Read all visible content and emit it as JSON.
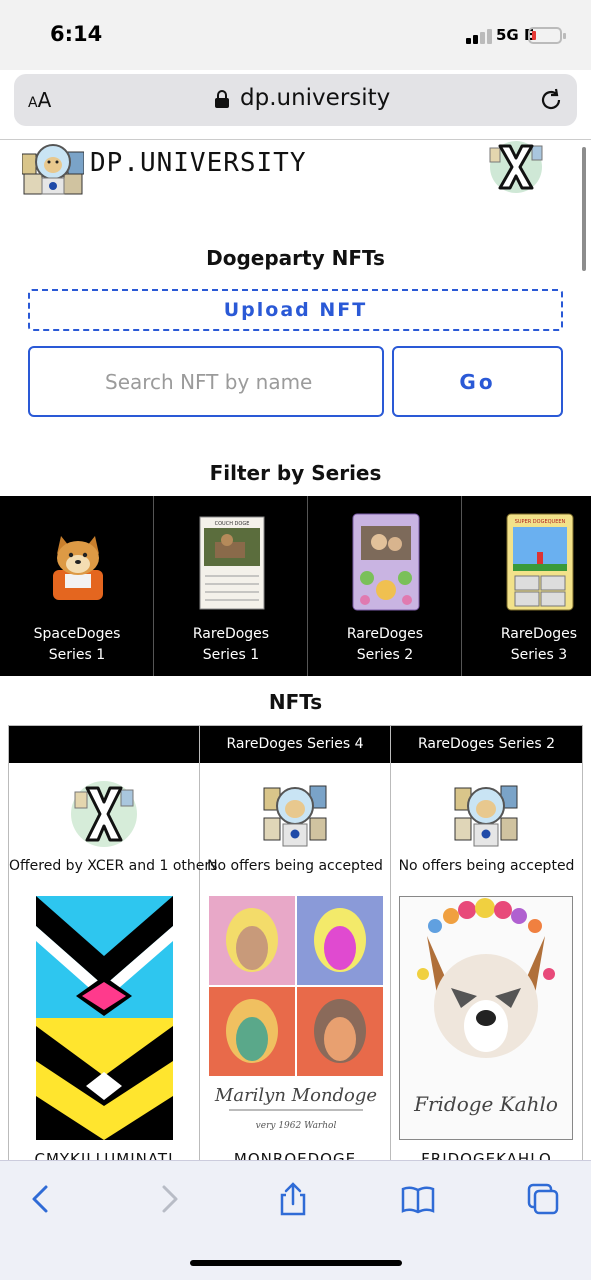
{
  "status_bar": {
    "time": "6:14",
    "network": "5G E"
  },
  "browser": {
    "aa_label": "AA",
    "domain": "dp.university"
  },
  "site": {
    "name": "DP.UNIVERSITY"
  },
  "main": {
    "title": "Dogeparty NFTs",
    "upload_label": "Upload NFT",
    "search_placeholder": "Search NFT by name",
    "go_label": "Go",
    "filter_title": "Filter by Series",
    "nfts_title": "NFTs"
  },
  "series": [
    {
      "line1": "SpaceDoges",
      "line2": "Series 1"
    },
    {
      "line1": "RareDoges",
      "line2": "Series 1"
    },
    {
      "line1": "RareDoges",
      "line2": "Series 2"
    },
    {
      "line1": "RareDoges",
      "line2": "Series 3"
    }
  ],
  "series_thumb_texts": {
    "couch": "COUCH DOGE",
    "super": "SUPER DOGEQUEEN"
  },
  "nfts": [
    {
      "series": "",
      "status": "Offered by XCER  and 1 others",
      "name": "CMYKILLUMINATI"
    },
    {
      "series": "RareDoges Series 4",
      "status": "No offers being accepted",
      "name": "MONROEDOGE"
    },
    {
      "series": "RareDoges Series 2",
      "status": "No offers being accepted",
      "name": "FRIDOGEKAHLO"
    }
  ],
  "art_text": {
    "monroe_title": "Marilyn Mondoge",
    "monroe_sub": "very 1962 Warhol",
    "frida_sig": "Fridoge Kahlo"
  },
  "colors": {
    "accent": "#2a59d6",
    "series_bg": "#000000"
  }
}
